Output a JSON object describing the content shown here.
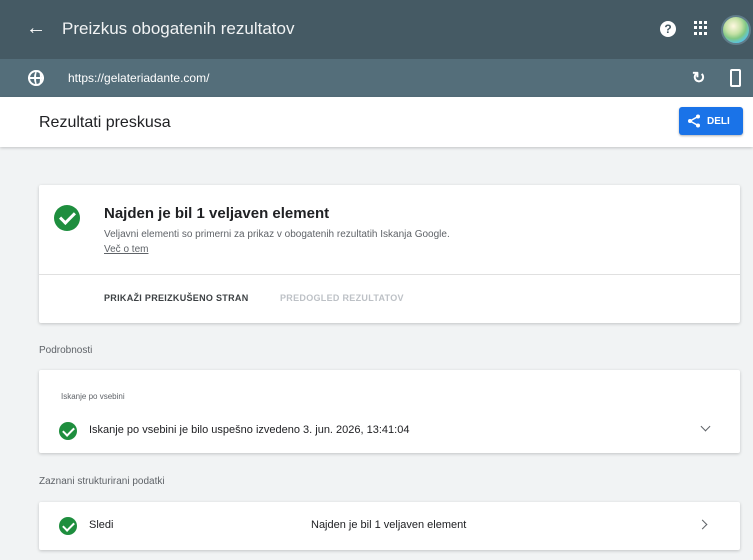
{
  "header": {
    "title": "Preizkus obogatenih rezultatov"
  },
  "urlbar": {
    "url": "https://gelateriadante.com/"
  },
  "results": {
    "heading": "Rezultati preskusa",
    "share_label": "DELI"
  },
  "summary": {
    "title": "Najden je bil 1 veljaven element",
    "description": "Veljavni elementi so primerni za prikaz v obogatenih rezultatih Iskanja Google.",
    "more_link": "Več o tem",
    "action_view_page": "PRIKAŽI PREIZKUŠENO STRAN",
    "action_preview": "PREDOGLED REZULTATOV"
  },
  "details": {
    "label": "Podrobnosti",
    "crawl_title": "Iskanje po vsebini",
    "crawl_status": "Iskanje po vsebini je bilo uspešno izvedeno 3. jun. 2026, 13:41:04"
  },
  "structured": {
    "label": "Zaznani strukturirani podatki",
    "items": [
      {
        "name": "Sledi",
        "status": "Najden je bil 1 veljaven element"
      }
    ]
  },
  "colors": {
    "topbar": "#455a64",
    "urlbar": "#546e7a",
    "accent": "#1a73e8",
    "success": "#1e8e3e"
  }
}
